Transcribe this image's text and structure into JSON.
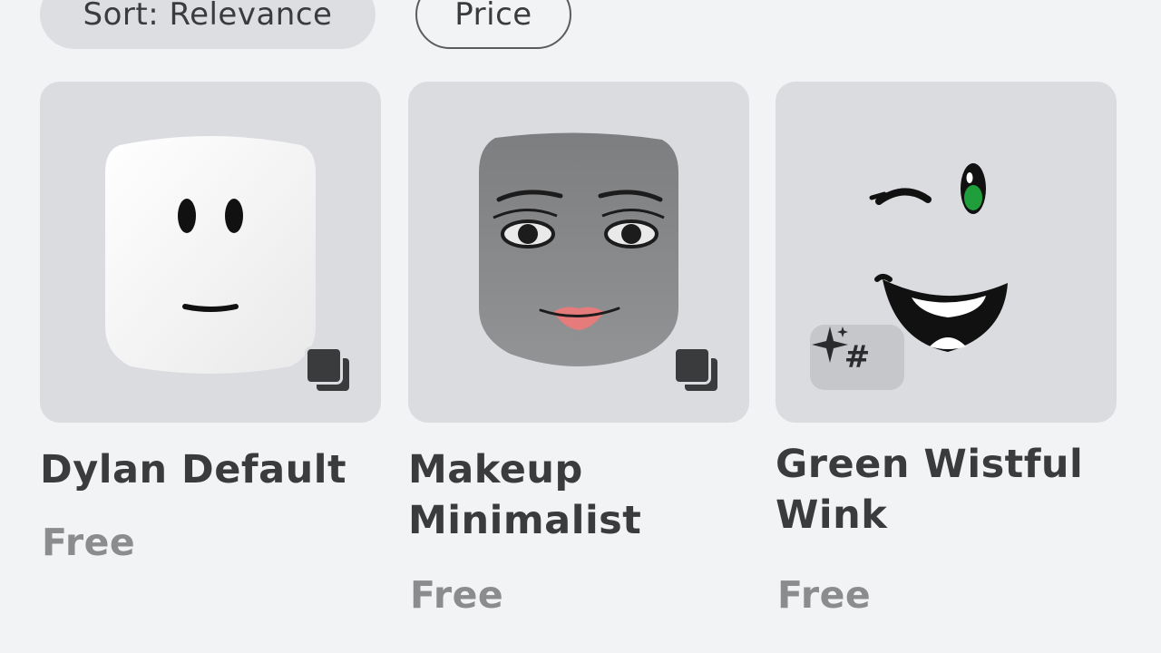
{
  "filters": {
    "sort_label": "Sort: Relevance",
    "price_label": "Price"
  },
  "items": [
    {
      "name": "Dylan Default",
      "price": "Free",
      "badge": "copies-icon"
    },
    {
      "name": "Makeup\nMinimalist",
      "price": "Free",
      "badge": "copies-icon"
    },
    {
      "name": "Green Wistful\nWink",
      "price": "Free",
      "badge_text": "#",
      "badge": "sparkle-icon"
    }
  ],
  "colors": {
    "background": "#f2f3f5",
    "card_background": "#dbdce0",
    "text_primary": "#393b3d",
    "text_price": "#8a8c8e",
    "wink_eye_green": "#1f9e3b"
  }
}
